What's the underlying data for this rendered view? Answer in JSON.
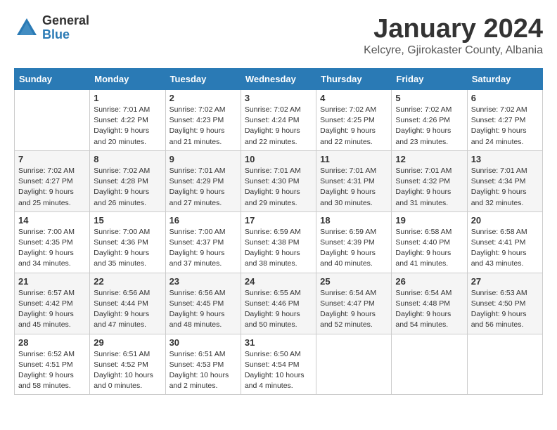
{
  "logo": {
    "general": "General",
    "blue": "Blue"
  },
  "title": "January 2024",
  "subtitle": "Kelcyre, Gjirokaster County, Albania",
  "headers": [
    "Sunday",
    "Monday",
    "Tuesday",
    "Wednesday",
    "Thursday",
    "Friday",
    "Saturday"
  ],
  "weeks": [
    [
      {
        "day": "",
        "sunrise": "",
        "sunset": "",
        "daylight": ""
      },
      {
        "day": "1",
        "sunrise": "Sunrise: 7:01 AM",
        "sunset": "Sunset: 4:22 PM",
        "daylight": "Daylight: 9 hours and 20 minutes."
      },
      {
        "day": "2",
        "sunrise": "Sunrise: 7:02 AM",
        "sunset": "Sunset: 4:23 PM",
        "daylight": "Daylight: 9 hours and 21 minutes."
      },
      {
        "day": "3",
        "sunrise": "Sunrise: 7:02 AM",
        "sunset": "Sunset: 4:24 PM",
        "daylight": "Daylight: 9 hours and 22 minutes."
      },
      {
        "day": "4",
        "sunrise": "Sunrise: 7:02 AM",
        "sunset": "Sunset: 4:25 PM",
        "daylight": "Daylight: 9 hours and 22 minutes."
      },
      {
        "day": "5",
        "sunrise": "Sunrise: 7:02 AM",
        "sunset": "Sunset: 4:26 PM",
        "daylight": "Daylight: 9 hours and 23 minutes."
      },
      {
        "day": "6",
        "sunrise": "Sunrise: 7:02 AM",
        "sunset": "Sunset: 4:27 PM",
        "daylight": "Daylight: 9 hours and 24 minutes."
      }
    ],
    [
      {
        "day": "7",
        "sunrise": "Sunrise: 7:02 AM",
        "sunset": "Sunset: 4:27 PM",
        "daylight": "Daylight: 9 hours and 25 minutes."
      },
      {
        "day": "8",
        "sunrise": "Sunrise: 7:02 AM",
        "sunset": "Sunset: 4:28 PM",
        "daylight": "Daylight: 9 hours and 26 minutes."
      },
      {
        "day": "9",
        "sunrise": "Sunrise: 7:01 AM",
        "sunset": "Sunset: 4:29 PM",
        "daylight": "Daylight: 9 hours and 27 minutes."
      },
      {
        "day": "10",
        "sunrise": "Sunrise: 7:01 AM",
        "sunset": "Sunset: 4:30 PM",
        "daylight": "Daylight: 9 hours and 29 minutes."
      },
      {
        "day": "11",
        "sunrise": "Sunrise: 7:01 AM",
        "sunset": "Sunset: 4:31 PM",
        "daylight": "Daylight: 9 hours and 30 minutes."
      },
      {
        "day": "12",
        "sunrise": "Sunrise: 7:01 AM",
        "sunset": "Sunset: 4:32 PM",
        "daylight": "Daylight: 9 hours and 31 minutes."
      },
      {
        "day": "13",
        "sunrise": "Sunrise: 7:01 AM",
        "sunset": "Sunset: 4:34 PM",
        "daylight": "Daylight: 9 hours and 32 minutes."
      }
    ],
    [
      {
        "day": "14",
        "sunrise": "Sunrise: 7:00 AM",
        "sunset": "Sunset: 4:35 PM",
        "daylight": "Daylight: 9 hours and 34 minutes."
      },
      {
        "day": "15",
        "sunrise": "Sunrise: 7:00 AM",
        "sunset": "Sunset: 4:36 PM",
        "daylight": "Daylight: 9 hours and 35 minutes."
      },
      {
        "day": "16",
        "sunrise": "Sunrise: 7:00 AM",
        "sunset": "Sunset: 4:37 PM",
        "daylight": "Daylight: 9 hours and 37 minutes."
      },
      {
        "day": "17",
        "sunrise": "Sunrise: 6:59 AM",
        "sunset": "Sunset: 4:38 PM",
        "daylight": "Daylight: 9 hours and 38 minutes."
      },
      {
        "day": "18",
        "sunrise": "Sunrise: 6:59 AM",
        "sunset": "Sunset: 4:39 PM",
        "daylight": "Daylight: 9 hours and 40 minutes."
      },
      {
        "day": "19",
        "sunrise": "Sunrise: 6:58 AM",
        "sunset": "Sunset: 4:40 PM",
        "daylight": "Daylight: 9 hours and 41 minutes."
      },
      {
        "day": "20",
        "sunrise": "Sunrise: 6:58 AM",
        "sunset": "Sunset: 4:41 PM",
        "daylight": "Daylight: 9 hours and 43 minutes."
      }
    ],
    [
      {
        "day": "21",
        "sunrise": "Sunrise: 6:57 AM",
        "sunset": "Sunset: 4:42 PM",
        "daylight": "Daylight: 9 hours and 45 minutes."
      },
      {
        "day": "22",
        "sunrise": "Sunrise: 6:56 AM",
        "sunset": "Sunset: 4:44 PM",
        "daylight": "Daylight: 9 hours and 47 minutes."
      },
      {
        "day": "23",
        "sunrise": "Sunrise: 6:56 AM",
        "sunset": "Sunset: 4:45 PM",
        "daylight": "Daylight: 9 hours and 48 minutes."
      },
      {
        "day": "24",
        "sunrise": "Sunrise: 6:55 AM",
        "sunset": "Sunset: 4:46 PM",
        "daylight": "Daylight: 9 hours and 50 minutes."
      },
      {
        "day": "25",
        "sunrise": "Sunrise: 6:54 AM",
        "sunset": "Sunset: 4:47 PM",
        "daylight": "Daylight: 9 hours and 52 minutes."
      },
      {
        "day": "26",
        "sunrise": "Sunrise: 6:54 AM",
        "sunset": "Sunset: 4:48 PM",
        "daylight": "Daylight: 9 hours and 54 minutes."
      },
      {
        "day": "27",
        "sunrise": "Sunrise: 6:53 AM",
        "sunset": "Sunset: 4:50 PM",
        "daylight": "Daylight: 9 hours and 56 minutes."
      }
    ],
    [
      {
        "day": "28",
        "sunrise": "Sunrise: 6:52 AM",
        "sunset": "Sunset: 4:51 PM",
        "daylight": "Daylight: 9 hours and 58 minutes."
      },
      {
        "day": "29",
        "sunrise": "Sunrise: 6:51 AM",
        "sunset": "Sunset: 4:52 PM",
        "daylight": "Daylight: 10 hours and 0 minutes."
      },
      {
        "day": "30",
        "sunrise": "Sunrise: 6:51 AM",
        "sunset": "Sunset: 4:53 PM",
        "daylight": "Daylight: 10 hours and 2 minutes."
      },
      {
        "day": "31",
        "sunrise": "Sunrise: 6:50 AM",
        "sunset": "Sunset: 4:54 PM",
        "daylight": "Daylight: 10 hours and 4 minutes."
      },
      {
        "day": "",
        "sunrise": "",
        "sunset": "",
        "daylight": ""
      },
      {
        "day": "",
        "sunrise": "",
        "sunset": "",
        "daylight": ""
      },
      {
        "day": "",
        "sunrise": "",
        "sunset": "",
        "daylight": ""
      }
    ]
  ]
}
